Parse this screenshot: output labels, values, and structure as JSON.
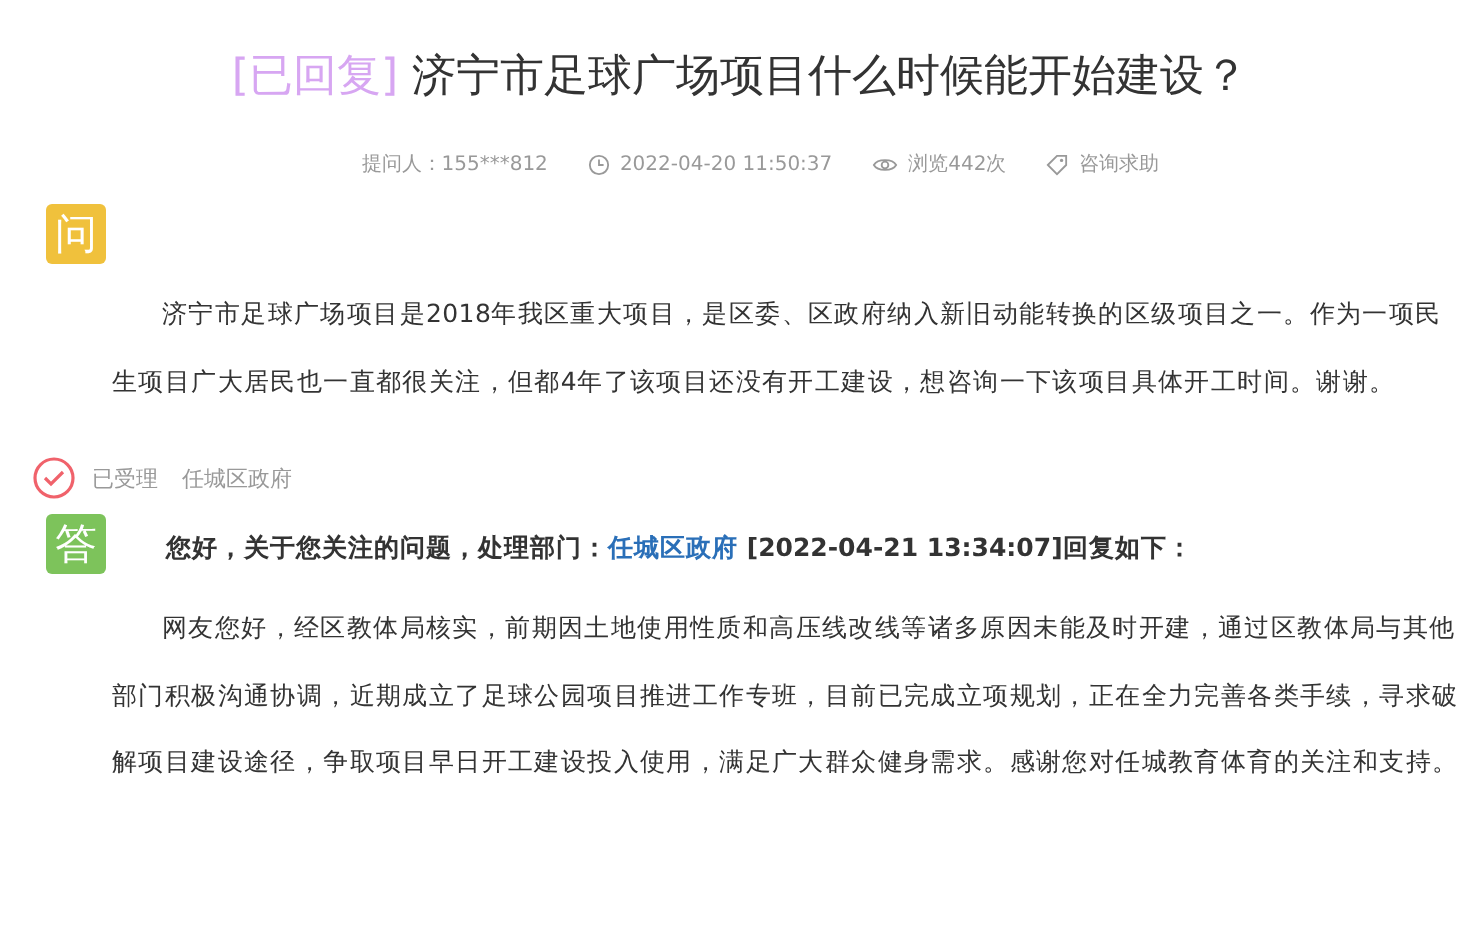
{
  "title": {
    "status": "[已回复]",
    "text": "济宁市足球广场项目什么时候能开始建设？"
  },
  "meta": {
    "asker": "提问人：155***812",
    "time": "2022-04-20 11:50:37",
    "views": "浏览442次",
    "category": "咨询求助"
  },
  "question": {
    "badge": "问",
    "text": "济宁市足球广场项目是2018年我区重大项目，是区委、区政府纳入新旧动能转换的区级项目之一。作为一项民生项目广大居民也一直都很关注，但都4年了该项目还没有开工建设，想咨询一下该项目具体开工时间。谢谢。"
  },
  "status": {
    "accepted": true,
    "label": "已受理",
    "department": "任城区政府"
  },
  "answer": {
    "badge": "答",
    "heading_prefix": "您好，关于您关注的问题，处理部门：",
    "department": "任城区政府",
    "heading_suffix": "[2022-04-21 13:34:07]回复如下：",
    "text": "网友您好，经区教体局核实，前期因土地使用性质和高压线改线等诸多原因未能及时开建，通过区教体局与其他部门积极沟通协调，近期成立了足球公园项目推进工作专班，目前已完成立项规划，正在全力完善各类手续，寻求破解项目建设途径，争取项目早日开工建设投入使用，满足广大群众健身需求。感谢您对任城教育体育的关注和支持。"
  }
}
